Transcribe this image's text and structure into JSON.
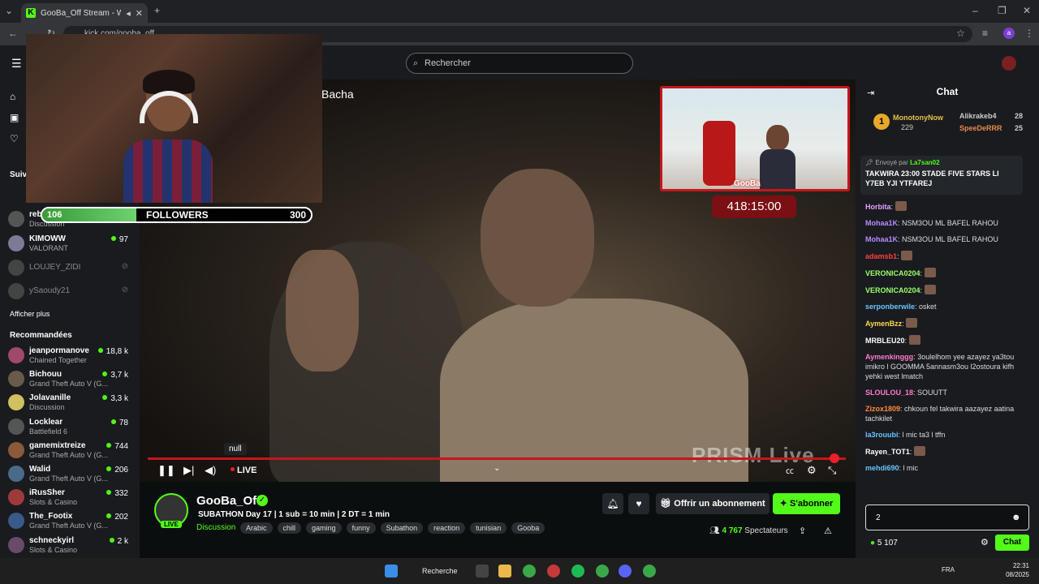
{
  "browser": {
    "tab_title": "GooBa_Off Stream - Watch",
    "url": "kick.com/gooba_off"
  },
  "header": {
    "search_placeholder": "Rechercher"
  },
  "overlay": {
    "followers_current": "106",
    "followers_label": "FOLLOWERS",
    "followers_goal": "300",
    "followers_progress": 0.35,
    "timer": "418:15:00",
    "pip_logo": "GooBa",
    "prism": "PRISM Live",
    "video_title": "Bacha"
  },
  "player": {
    "tooltip": "null",
    "live_label": "LIVE"
  },
  "sidebar": {
    "following_title": "Suiv",
    "following": [
      {
        "name": "reb",
        "category": "Discussion",
        "viewers": "",
        "online": true
      },
      {
        "name": "KIMOWW",
        "category": "VALORANT",
        "viewers": "97",
        "online": true
      },
      {
        "name": "LOUJEY_ZIDI",
        "category": "",
        "viewers": "",
        "online": false
      },
      {
        "name": "ySaoudy21",
        "category": "",
        "viewers": "",
        "online": false
      }
    ],
    "show_more": "Afficher plus",
    "recommended_title": "Recommandées",
    "recommended": [
      {
        "name": "jeanpormanove",
        "category": "Chained Together",
        "viewers": "18,8 k"
      },
      {
        "name": "Bichouu",
        "category": "Grand Theft Auto V (G...",
        "viewers": "3,7 k"
      },
      {
        "name": "Jolavanille",
        "category": "Discussion",
        "viewers": "3,3 k"
      },
      {
        "name": "Locklear",
        "category": "Battlefield 6",
        "viewers": "78"
      },
      {
        "name": "gamemixtreize",
        "category": "Grand Theft Auto V (G...",
        "viewers": "744"
      },
      {
        "name": "Walid",
        "category": "Grand Theft Auto V (G...",
        "viewers": "206"
      },
      {
        "name": "iRusSher",
        "category": "Slots & Casino",
        "viewers": "332"
      },
      {
        "name": "The_Footix",
        "category": "Grand Theft Auto V (G...",
        "viewers": "202"
      },
      {
        "name": "schneckyirl",
        "category": "Slots & Casino",
        "viewers": "2 k"
      }
    ]
  },
  "stream": {
    "channel": "GooBa_Off",
    "live_badge": "LIVE",
    "title": "SUBATHON Day 17 | 1 sub = 10 min | 2 DT = 1 min",
    "category": "Discussion",
    "tags": [
      "Arabic",
      "chill",
      "gaming",
      "funny",
      "Subathon",
      "reaction",
      "tunisian",
      "Gooba"
    ],
    "gift_label": "Offrir un abonnement",
    "subscribe_label": "S'abonner",
    "viewers_count": "4 767",
    "viewers_label": "Spectateurs"
  },
  "chat": {
    "title": "Chat",
    "leaderboard": [
      {
        "rank": "1",
        "name": "MonotonyNow",
        "score": "229"
      },
      {
        "rank": "",
        "name": "Alikrakeb4",
        "score": "28"
      },
      {
        "rank": "",
        "name": "SpeeDeRRR",
        "score": "25"
      }
    ],
    "pinned_by_label": "Envoyé par",
    "pinned_by_user": "La7san02",
    "pinned_text": "TAKWIRA 23:00 STADE FIVE STARS LI Y7EB YJI YTFAREJ",
    "messages": [
      {
        "user": "Horbita",
        "text": "",
        "color": "#e8a0ff"
      },
      {
        "user": "Mohaa1K",
        "text": "NSM3OU ML BAFEL RAHOU",
        "color": "#b48cff"
      },
      {
        "user": "Mohaa1K",
        "text": "NSM3OU ML BAFEL RAHOU",
        "color": "#b48cff"
      },
      {
        "user": "adamsb1",
        "text": "",
        "color": "#ff4040"
      },
      {
        "user": "VERONICA0204",
        "text": "",
        "color": "#9cff6b"
      },
      {
        "user": "VERONICA0204",
        "text": "",
        "color": "#9cff6b"
      },
      {
        "user": "serponberwile",
        "text": "osket",
        "color": "#6bc4ff"
      },
      {
        "user": "AymenBzz",
        "text": "",
        "color": "#ffd84a"
      },
      {
        "user": "MRBLEU20",
        "text": "",
        "color": "#ffffff"
      },
      {
        "user": "Aymenkinggg",
        "text": "3oulelhom yee azayez ya3tou imikro l GOOMMA 5annasm3ou l2ostoura kifh yehki west lmatch",
        "color": "#ff7acb"
      },
      {
        "user": "SLOULOU_18",
        "text": "SOUUTT",
        "color": "#ff7acb"
      },
      {
        "user": "Zizox1809",
        "text": "chkoun fel takwira aazayez aatina tachkilet",
        "color": "#ff8c3a"
      },
      {
        "user": "la3rouubi",
        "text": "l mic ta3 l tffn",
        "color": "#6bc4ff"
      },
      {
        "user": "Rayen_TOT1",
        "text": "",
        "color": "#ffffff"
      },
      {
        "user": "mehdi690",
        "text": "l mic",
        "color": "#6bc4ff"
      }
    ],
    "input_value": "2",
    "points": "5 107",
    "send_label": "Chat"
  },
  "taskbar": {
    "search_label": "Recherche",
    "lang": "FRA",
    "time": "22:31",
    "date": "08/2025"
  },
  "colors": {
    "accent": "#53fc18",
    "live_red": "#c4171a"
  }
}
